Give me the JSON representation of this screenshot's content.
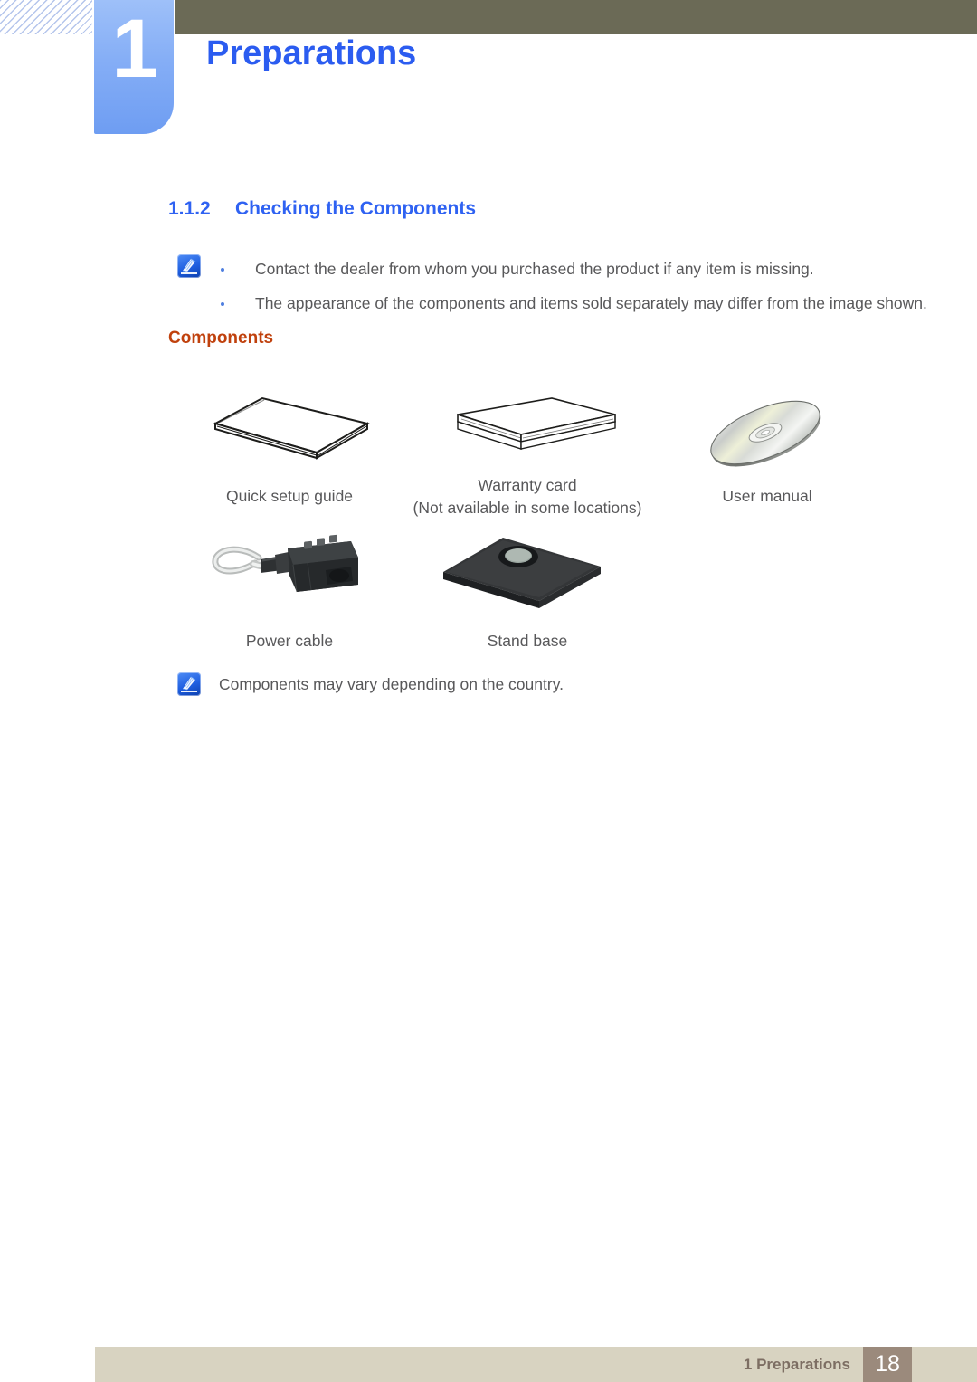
{
  "header": {
    "chapter_number": "1",
    "chapter_title": "Preparations"
  },
  "section": {
    "number": "1.1.2",
    "title": "Checking the Components"
  },
  "top_note": {
    "icon": "note-pen-icon",
    "bullets": [
      "Contact the dealer from whom you purchased the product if any item is missing.",
      "The appearance of the components and items sold separately may differ from the image shown."
    ]
  },
  "components_heading": "Components",
  "components": [
    {
      "icon": "booklet-icon",
      "caption": "Quick setup guide",
      "caption_line2": ""
    },
    {
      "icon": "card-stack-icon",
      "caption": "Warranty card",
      "caption_line2": "(Not available in some locations)"
    },
    {
      "icon": "cd-disc-icon",
      "caption": "User manual",
      "caption_line2": ""
    },
    {
      "icon": "power-plug-icon",
      "caption": "Power cable",
      "caption_line2": ""
    },
    {
      "icon": "stand-base-icon",
      "caption": "Stand base",
      "caption_line2": ""
    }
  ],
  "bottom_note": {
    "icon": "note-pen-icon",
    "text": "Components may vary depending on the country."
  },
  "footer": {
    "label": "1 Preparations",
    "page_number": "18"
  },
  "colors": {
    "chapter_blue": "#2b5cf0",
    "section_blue": "#2f62f2",
    "components_orange": "#c0410d",
    "olive_bar": "#6b6a56",
    "footer_band": "#d8d3c1",
    "footer_page_box": "#9b8a7c",
    "body_text": "#58585a"
  }
}
